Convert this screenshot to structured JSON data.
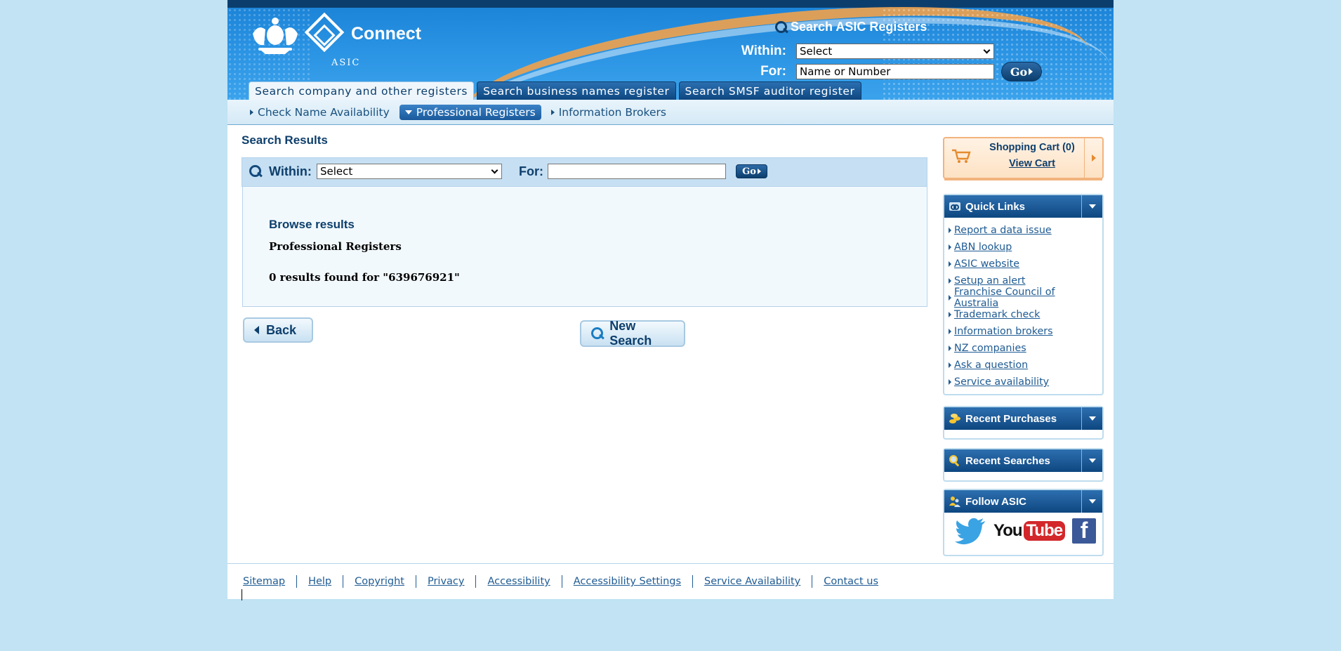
{
  "header": {
    "brand": "Connect",
    "org": "ASIC",
    "search_title": "Search ASIC Registers",
    "within_label": "Within:",
    "within_value": "Select",
    "for_label": "For:",
    "for_placeholder": "Name or Number",
    "go_label": "Go"
  },
  "tabs": [
    {
      "label": "Search company and other registers",
      "active": true
    },
    {
      "label": "Search business names register",
      "active": false
    },
    {
      "label": "Search SMSF auditor register",
      "active": false
    }
  ],
  "subnav": [
    {
      "label": "Check Name Availability",
      "active": false
    },
    {
      "label": "Professional Registers",
      "active": true
    },
    {
      "label": "Information Brokers",
      "active": false
    }
  ],
  "main": {
    "title": "Search Results",
    "search": {
      "within_label": "Within:",
      "within_value": "Select",
      "for_label": "For:",
      "for_value": "",
      "go_label": "Go"
    },
    "results": {
      "heading": "Browse results",
      "register": "Professional Registers",
      "count_text": "0 results found for \"639676921\""
    },
    "back_label": "Back",
    "new_search_label": "New Search"
  },
  "sidebar": {
    "cart": {
      "title": "Shopping Cart (0)",
      "link": "View Cart"
    },
    "quick_links": {
      "title": "Quick Links",
      "items": [
        "Report a data issue",
        "ABN lookup",
        "ASIC website",
        "Setup an alert",
        "Franchise Council of Australia",
        "Trademark check",
        "Information brokers",
        "NZ companies",
        "Ask a question",
        "Service availability"
      ]
    },
    "recent_purchases": {
      "title": "Recent Purchases"
    },
    "recent_searches": {
      "title": "Recent Searches"
    },
    "follow": {
      "title": "Follow ASIC",
      "youtube_you": "You",
      "youtube_tube": "Tube",
      "facebook": "f"
    }
  },
  "footer": {
    "links": [
      "Sitemap",
      "Help",
      "Copyright",
      "Privacy",
      "Accessibility",
      "Accessibility Settings",
      "Service Availability",
      "Contact us"
    ]
  },
  "colors": {
    "page_bg": "#c1e3f3",
    "header_blue": "#1a82d6",
    "navy": "#0e3f6c",
    "link": "#1f5b93",
    "accent_orange": "#f0a24d"
  }
}
